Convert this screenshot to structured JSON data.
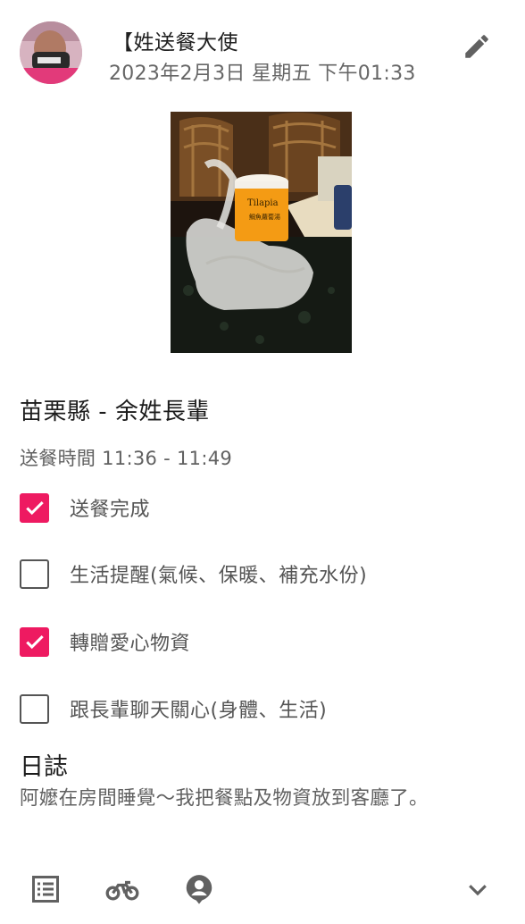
{
  "post": {
    "author": "【姓送餐大使",
    "datetime": "2023年2月3日 星期五 下午01:33",
    "location": "苗栗縣 - 余姓長輩",
    "delivery_time": "送餐時間 11:36 - 11:49"
  },
  "tasks": [
    {
      "label": "送餐完成",
      "checked": true
    },
    {
      "label": "生活提醒(氣候、保暖、補充水份)",
      "checked": false
    },
    {
      "label": "轉贈愛心物資",
      "checked": true
    },
    {
      "label": "跟長輩聊天關心(身體、生活)",
      "checked": false
    }
  ],
  "log": {
    "title": "日誌",
    "text": "阿嬤在房間睡覺～我把餐點及物資放到客廳了。"
  },
  "photo": {
    "can_label_brand": "Tilapia",
    "can_label_text": "鯛魚蘿蔔湯"
  },
  "colors": {
    "accent": "#ee1a61",
    "icon": "#616161"
  },
  "icons": {
    "edit": "pencil-icon",
    "list": "list-icon",
    "bike": "motorcycle-icon",
    "person": "person-pin-icon",
    "expand": "chevron-down-icon"
  }
}
